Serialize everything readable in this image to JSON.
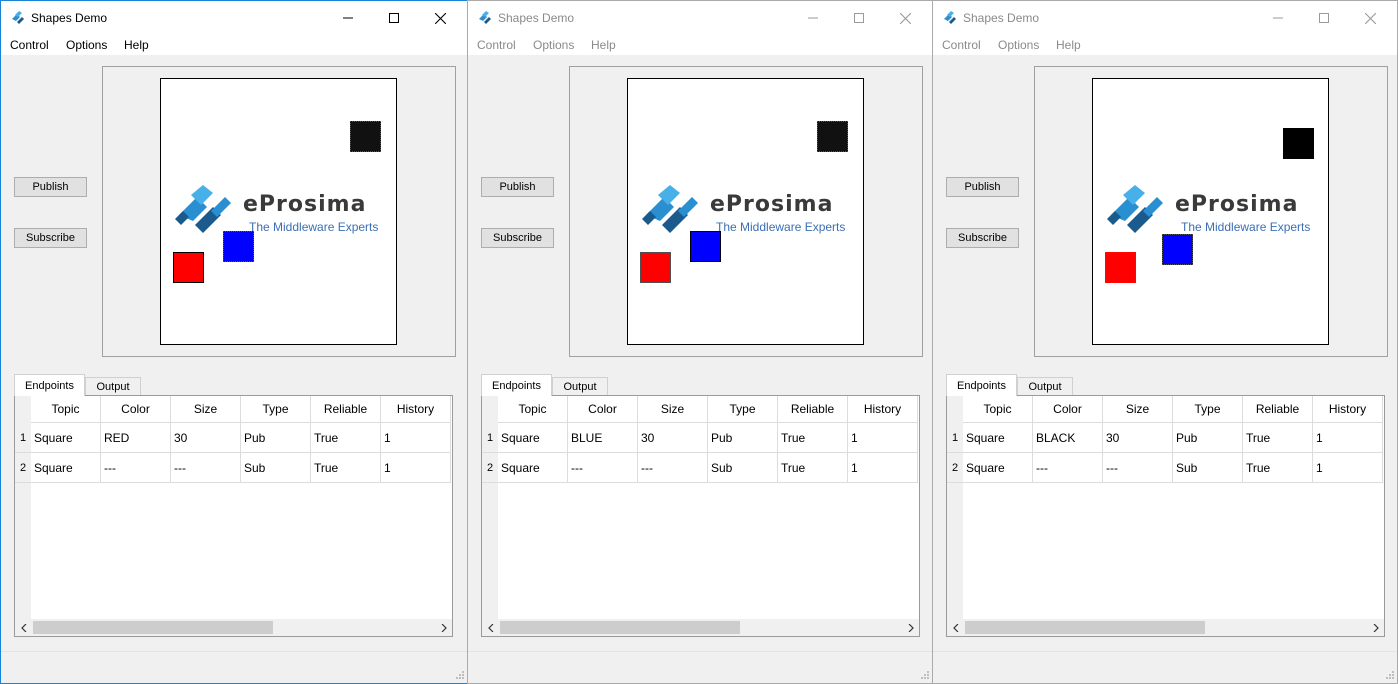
{
  "windows": [
    {
      "title": "Shapes Demo",
      "active": true,
      "menu": [
        "Control",
        "Options",
        "Help"
      ],
      "publish_label": "Publish",
      "subscribe_label": "Subscribe",
      "logo": {
        "name": "eProsima",
        "tagline": "The Middleware Experts"
      },
      "shapes": [
        {
          "kind": "sub",
          "color": "#111111"
        },
        {
          "kind": "pub",
          "color": "#ff0000"
        },
        {
          "kind": "sub",
          "color": "#0000ff"
        }
      ],
      "tabs": [
        "Endpoints",
        "Output"
      ],
      "columns": [
        "Topic",
        "Color",
        "Size",
        "Type",
        "Reliable",
        "History"
      ],
      "rows": [
        {
          "num": "1",
          "cells": [
            "Square",
            "RED",
            "30",
            "Pub",
            "True",
            "1"
          ]
        },
        {
          "num": "2",
          "cells": [
            "Square",
            "---",
            "---",
            "Sub",
            "True",
            "1"
          ]
        }
      ]
    },
    {
      "title": "Shapes Demo",
      "active": false,
      "menu": [
        "Control",
        "Options",
        "Help"
      ],
      "publish_label": "Publish",
      "subscribe_label": "Subscribe",
      "logo": {
        "name": "eProsima",
        "tagline": "The Middleware Experts"
      },
      "shapes": [
        {
          "kind": "sub",
          "color": "#111111"
        },
        {
          "kind": "sub",
          "color": "#ff0000"
        },
        {
          "kind": "pub",
          "color": "#0000ff"
        }
      ],
      "tabs": [
        "Endpoints",
        "Output"
      ],
      "columns": [
        "Topic",
        "Color",
        "Size",
        "Type",
        "Reliable",
        "History"
      ],
      "rows": [
        {
          "num": "1",
          "cells": [
            "Square",
            "BLUE",
            "30",
            "Pub",
            "True",
            "1"
          ]
        },
        {
          "num": "2",
          "cells": [
            "Square",
            "---",
            "---",
            "Sub",
            "True",
            "1"
          ]
        }
      ]
    },
    {
      "title": "Shapes Demo",
      "active": false,
      "menu": [
        "Control",
        "Options",
        "Help"
      ],
      "publish_label": "Publish",
      "subscribe_label": "Subscribe",
      "logo": {
        "name": "eProsima",
        "tagline": "The Middleware Experts"
      },
      "shapes": [
        {
          "kind": "pub",
          "color": "#000000"
        },
        {
          "kind": "sub",
          "color": "#ff0000"
        },
        {
          "kind": "sub",
          "color": "#0000ff"
        }
      ],
      "tabs": [
        "Endpoints",
        "Output"
      ],
      "columns": [
        "Topic",
        "Color",
        "Size",
        "Type",
        "Reliable",
        "History"
      ],
      "rows": [
        {
          "num": "1",
          "cells": [
            "Square",
            "BLACK",
            "30",
            "Pub",
            "True",
            "1"
          ]
        },
        {
          "num": "2",
          "cells": [
            "Square",
            "---",
            "---",
            "Sub",
            "True",
            "1"
          ]
        }
      ]
    }
  ]
}
